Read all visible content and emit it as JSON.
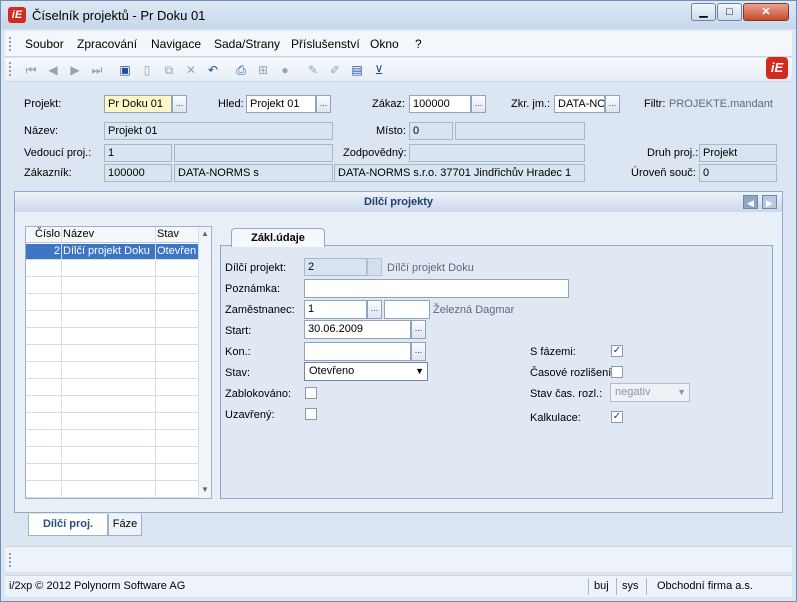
{
  "window": {
    "title": "Číselník projektů - Pr Doku 01",
    "logo_text": "iE",
    "min": "▁",
    "max": "□",
    "close": "✕"
  },
  "menu": [
    "Soubor",
    "Zpracování",
    "Navigace",
    "Sada/Strany",
    "Příslušenství",
    "Okno",
    "?"
  ],
  "toolbar_icons": [
    "first-record-icon",
    "prev-record-icon",
    "next-record-icon",
    "last-record-icon",
    "save-icon",
    "new-icon",
    "copy-icon",
    "delete-icon",
    "undo-icon",
    "print-icon",
    "tree-icon",
    "disabled-icon",
    "edit-icon",
    "pencil-icon",
    "table-edit-icon",
    "filter-icon"
  ],
  "header": {
    "projekt_label": "Projekt:",
    "projekt_value": "Pr Doku 01",
    "hled_label": "Hled:",
    "hled_value": "Projekt 01",
    "zakaz_label": "Zákaz:",
    "zakaz_value": "100000",
    "zkr_label": "Zkr. jm.:",
    "zkr_value": "DATA-NO",
    "filtr_label": "Filtr:",
    "filtr_value": "PROJEKTE.mandant",
    "nazev_label": "Název:",
    "nazev_value": "Projekt 01",
    "misto_label": "Místo:",
    "misto_value": "0",
    "vedouci_label": "Vedoucí proj.:",
    "vedouci_value": "1",
    "zodp_label": "Zodpovědný:",
    "druh_label": "Druh proj.:",
    "druh_value": "Projekt",
    "zakaznik_label": "Zákazník:",
    "zakaznik_num": "100000",
    "zakaznik_name": "DATA-NORMS s",
    "zakaznik_full": "DATA-NORMS s.r.o. 37701 Jindřichův Hradec 1",
    "uroven_label": "Úroveň souč:",
    "uroven_value": "0",
    "ellipsis": "..."
  },
  "section": {
    "title": "Dílčí projekty",
    "prev": "◀",
    "next": "▶"
  },
  "grid": {
    "columns": [
      "Číslo",
      "Název",
      "Stav"
    ],
    "rows": [
      {
        "cislo": "2",
        "nazev": "Dílčí projekt Doku",
        "stav": "Otevřen"
      }
    ],
    "scroll_up": "▲",
    "scroll_down": "▼"
  },
  "detail": {
    "tab": "Zákl.údaje",
    "dilci_label": "Dílčí projekt:",
    "dilci_value": "2",
    "dilci_name": "Dílčí projekt Doku",
    "poznamka_label": "Poznámka:",
    "zamestnanec_label": "Zaměstnanec:",
    "zamestnanec_value": "1",
    "zamestnanec_name": "Železná Dagmar",
    "start_label": "Start:",
    "start_value": "30.06.2009",
    "kon_label": "Kon.:",
    "stav_label": "Stav:",
    "stav_value": "Otevřeno",
    "zablokovano_label": "Zablokováno:",
    "uzavreny_label": "Uzavřený:",
    "sfazemi_label": "S fázemi:",
    "sfazemi_checked": true,
    "casove_label": "Časové rozlišení:",
    "casove_checked": false,
    "stavcas_label": "Stav čas. rozl.:",
    "stavcas_value": "negativ",
    "kalkulace_label": "Kalkulace:",
    "kalkulace_checked": true,
    "check_mark": "✓",
    "dropdown_arrow": "▼"
  },
  "bottom_tabs": [
    "Dílčí proj.",
    "Fáze"
  ],
  "statusbar": {
    "copyright": "i/2xp © 2012 Polynorm Software AG",
    "user": "buj",
    "sys": "sys",
    "company": "Obchodní firma a.s."
  }
}
